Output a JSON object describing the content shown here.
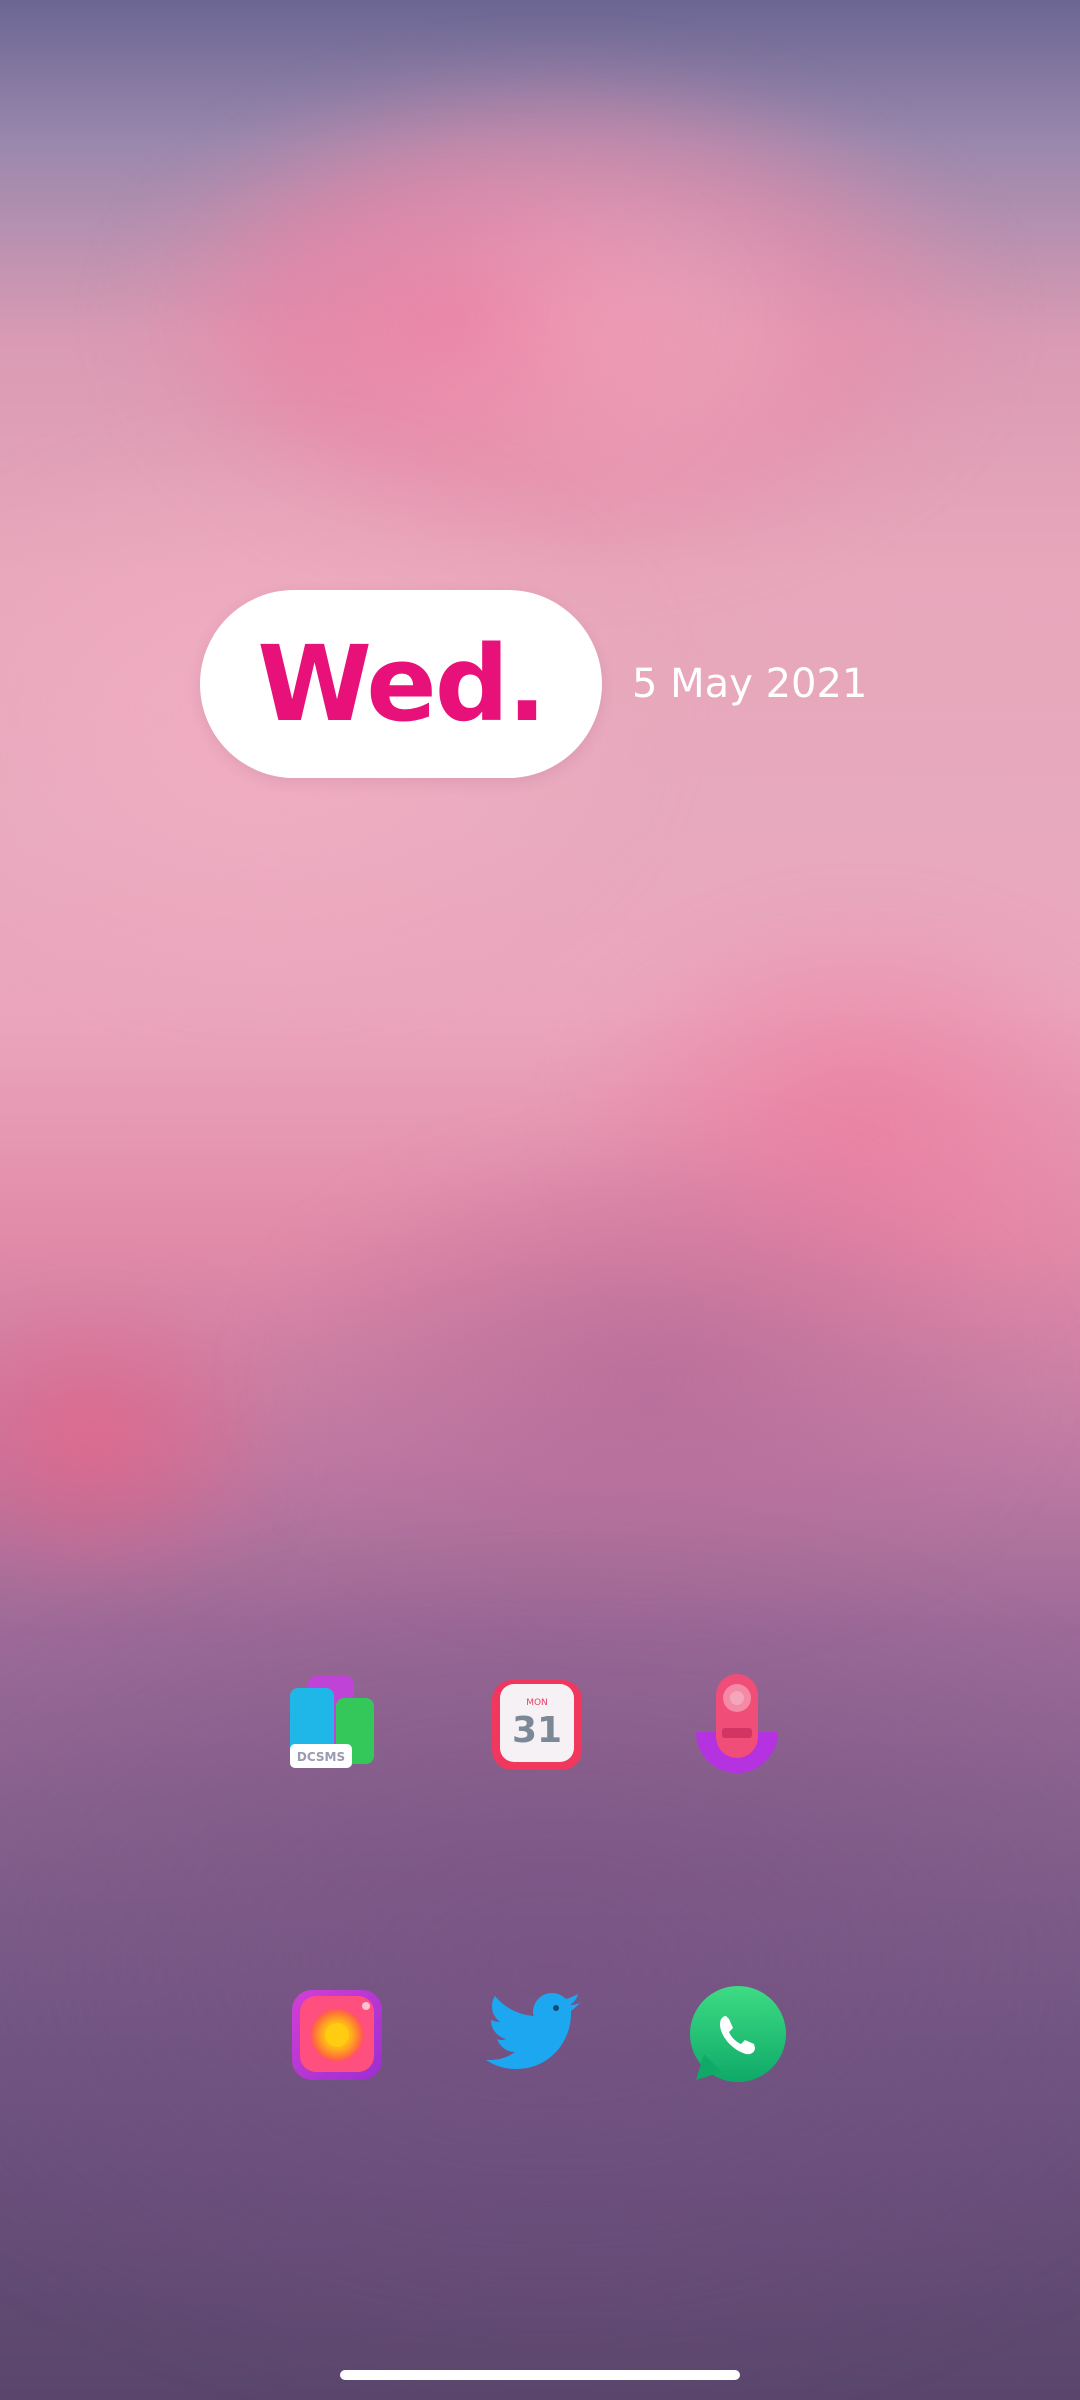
{
  "widget": {
    "day": "Wed.",
    "date": "5 May 2021"
  },
  "home_apps": [
    {
      "icon": "docs-icon",
      "label_on_icon": "DCSMS"
    },
    {
      "icon": "calendar-icon",
      "weekday": "MON",
      "daynum": "31"
    },
    {
      "icon": "recorder-icon"
    },
    {
      "icon": "camera-icon"
    },
    {
      "icon": "twitter-icon"
    },
    {
      "icon": "whatsapp-icon"
    }
  ],
  "colors": {
    "accent": "#e8117a",
    "widget_bg": "#ffffff",
    "text_light": "#ffffff"
  }
}
